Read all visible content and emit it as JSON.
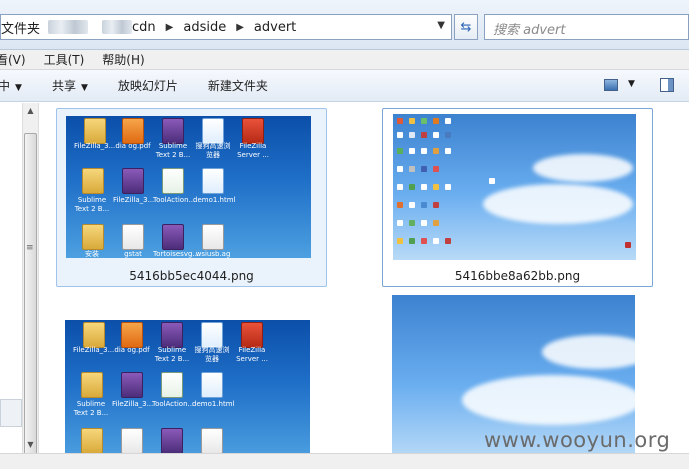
{
  "address": {
    "crumbs_visible": [
      "文件夹",
      "cdn",
      "adside",
      "advert"
    ]
  },
  "search": {
    "placeholder": "搜索 advert"
  },
  "menu": {
    "items": [
      "看(V)",
      "工具(T)",
      "帮助(H)"
    ]
  },
  "toolbar": {
    "items": [
      "中",
      "共享",
      "放映幻灯片",
      "新建文件夹"
    ]
  },
  "files": [
    {
      "name": "5416bb5ec4044.png",
      "state": "hover"
    },
    {
      "name": "5416bbe8a62bb.png",
      "state": "selected"
    },
    {
      "name": "",
      "state": "normal"
    },
    {
      "name": "",
      "state": "normal"
    }
  ],
  "desktop_labels": {
    "row1": [
      "FileZilla_3...",
      "dia og.pdf",
      "Sublime Text 2 B...",
      "搜狗高速浏览器",
      "FileZilla Server ..."
    ],
    "row2": [
      "Sublime Text 2 B...",
      "FileZilla_3...",
      "ToolAction...",
      "demo1.html"
    ],
    "row3": [
      "安装",
      "gstat",
      "Tortoisesvg...",
      "wsiusb.ag"
    ]
  },
  "watermark": "www.wooyun.org",
  "colors": {
    "accent": "#3b6fb0",
    "selection": "#eaf3fc"
  }
}
